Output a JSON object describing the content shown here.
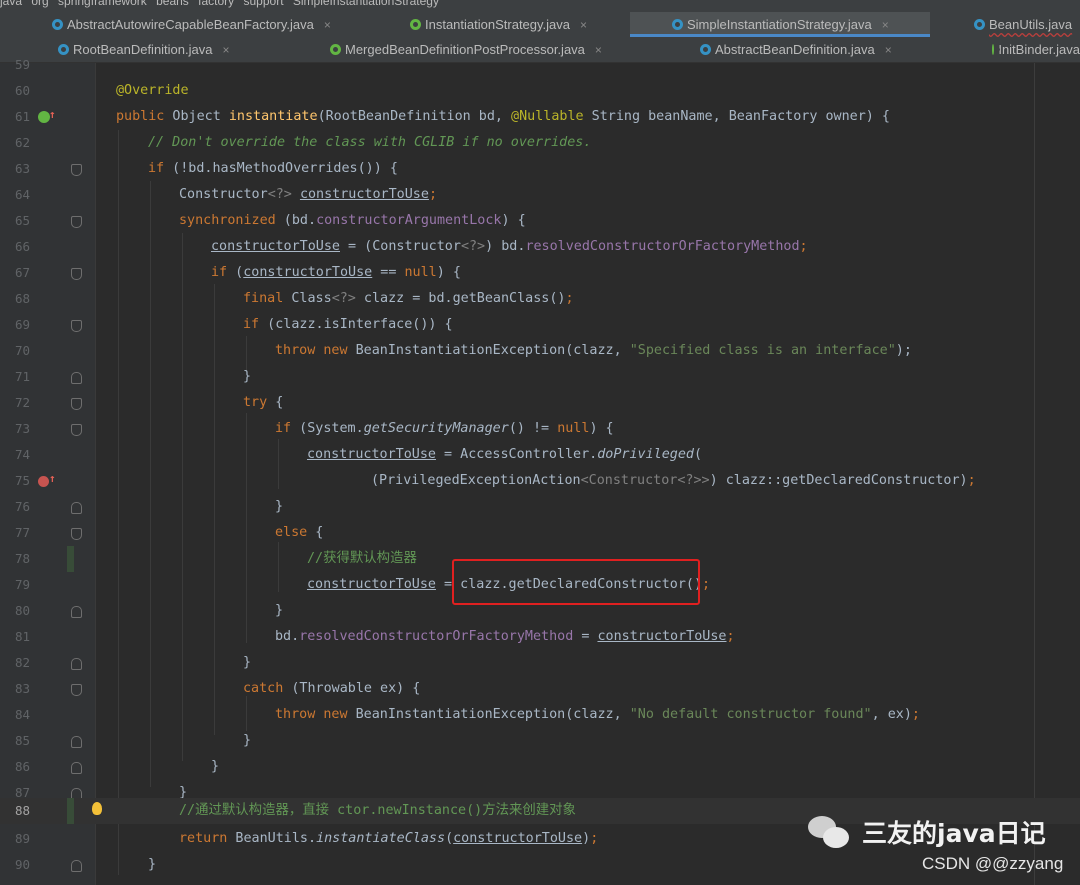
{
  "breadcrumb": [
    "java",
    "org",
    "springframework",
    "beans",
    "factory",
    "support",
    "SimpleInstantiationStrategy"
  ],
  "tabs_row1": [
    {
      "label": "AbstractAutowireCapableBeanFactory.java",
      "icon": "class-icon"
    },
    {
      "label": "InstantiationStrategy.java",
      "icon": "interface-icon"
    },
    {
      "label": "SimpleInstantiationStrategy.java",
      "icon": "class-icon",
      "active": true
    },
    {
      "label": "BeanUtils.java",
      "icon": "class-icon"
    }
  ],
  "tabs_row2": [
    {
      "label": "RootBeanDefinition.java",
      "icon": "class-icon"
    },
    {
      "label": "MergedBeanDefinitionPostProcessor.java",
      "icon": "interface-icon"
    },
    {
      "label": "AbstractBeanDefinition.java",
      "icon": "class-icon"
    },
    {
      "label": "InitBinder.java",
      "icon": "annotation-icon"
    }
  ],
  "tab_close_glyph": "×",
  "line_numbers": [
    "59",
    "60",
    "61",
    "62",
    "63",
    "64",
    "65",
    "66",
    "67",
    "68",
    "69",
    "70",
    "71",
    "72",
    "73",
    "74",
    "75",
    "76",
    "77",
    "78",
    "79",
    "80",
    "81",
    "82",
    "83",
    "84",
    "85",
    "86",
    "87",
    "88",
    "89",
    "90"
  ],
  "code": {
    "l60": "@Override",
    "l61_kw": "public",
    "l61_a": " Object ",
    "l61_method": "instantiate",
    "l61_b": "(RootBeanDefinition bd, ",
    "l61_ann": "@Nullable",
    "l61_c": " String beanName, BeanFactory owner) {",
    "l62": "// Don't override the class with CGLIB if no overrides.",
    "l63_kw": "if",
    "l63_a": " (!bd.hasMethodOverrides()) {",
    "l64_a": "Constructor",
    "l64_b": "<?>",
    "l64_var": "constructorToUse",
    "l64_c": ";",
    "l65_kw": "synchronized",
    "l65_a": " (bd.",
    "l65_fld": "constructorArgumentLock",
    "l65_b": ") {",
    "l66_var": "constructorToUse",
    "l66_a": " = (Constructor",
    "l66_b": "<?>",
    "l66_c": ") bd.",
    "l66_fld": "resolvedConstructorOrFactoryMethod",
    "l66_d": ";",
    "l67_kw": "if",
    "l67_a": " (",
    "l67_var": "constructorToUse",
    "l67_b": " == ",
    "l67_null": "null",
    "l67_c": ") {",
    "l68_kw": "final",
    "l68_a": " Class",
    "l68_b": "<?>",
    "l68_c": " clazz = bd.getBeanClass()",
    "l68_d": ";",
    "l69_kw": "if",
    "l69_a": " (clazz.isInterface()) {",
    "l70_kw1": "throw",
    "l70_kw2": "new",
    "l70_a": " BeanInstantiationException(clazz, ",
    "l70_str": "\"Specified class is an interface\"",
    "l70_b": ");",
    "l71": "}",
    "l72_kw": "try",
    "l72_a": " {",
    "l73_kw": "if",
    "l73_a": " (System.",
    "l73_ital": "getSecurityManager",
    "l73_b": "() != ",
    "l73_null": "null",
    "l73_c": ") {",
    "l74_var": "constructorToUse",
    "l74_a": " = AccessController.",
    "l74_ital": "doPrivileged",
    "l74_b": "(",
    "l75_a": "(PrivilegedExceptionAction",
    "l75_b": "<Constructor<?>>",
    "l75_c": ") clazz::getDeclaredConstructor)",
    "l75_d": ";",
    "l76": "}",
    "l77_kw": "else",
    "l77_a": " {",
    "l78": "//获得默认构造器",
    "l79_var": "constructorToUse",
    "l79_a": " = clazz.getDeclaredConstructor()",
    "l79_b": ";",
    "l80": "}",
    "l81_a": "bd.",
    "l81_fld": "resolvedConstructorOrFactoryMethod",
    "l81_b": " = ",
    "l81_var": "constructorToUse",
    "l81_c": ";",
    "l82": "}",
    "l83_kw": "catch",
    "l83_a": " (Throwable ex) {",
    "l84_kw1": "throw",
    "l84_kw2": "new",
    "l84_a": " BeanInstantiationException(clazz, ",
    "l84_str": "\"No default constructor found\"",
    "l84_b": ", ex)",
    "l84_c": ";",
    "l85": "}",
    "l86": "}",
    "l87": "}",
    "l88": "//通过默认构造器，直接 ctor.newInstance()方法来创建对象",
    "l89_kw": "return",
    "l89_a": " BeanUtils.",
    "l89_ital": "instantiateClass",
    "l89_b": "(",
    "l89_var": "constructorToUse",
    "l89_c": ")",
    "l89_d": ";",
    "l90": "}"
  },
  "watermark": {
    "text": "三友的java日记",
    "icon": "wechat-icon"
  },
  "csdn": "CSDN @@zzyang"
}
